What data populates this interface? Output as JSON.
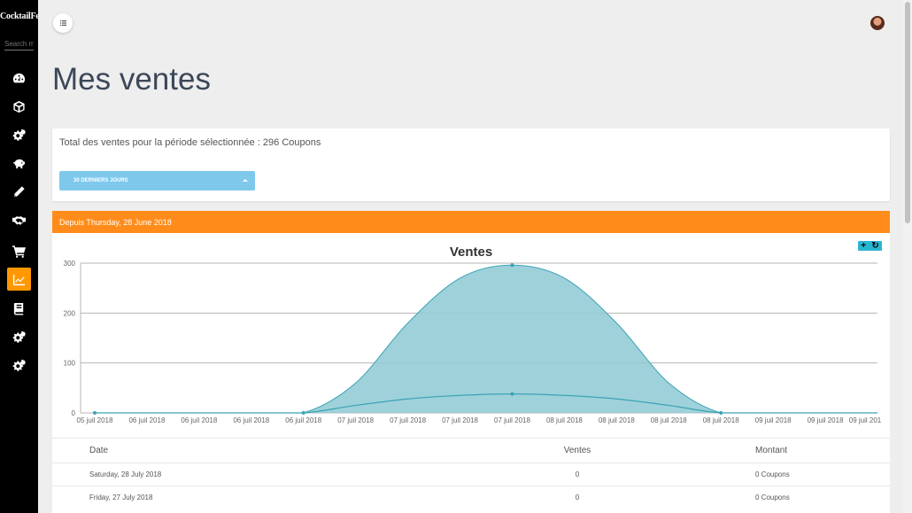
{
  "sidebar": {
    "brand": "CocktailFest",
    "search_placeholder": "Search menu",
    "items": [
      {
        "icon": "dashboard-icon"
      },
      {
        "icon": "cube-icon"
      },
      {
        "icon": "cogs-icon"
      },
      {
        "icon": "piggy-bank-icon"
      },
      {
        "icon": "pencil-icon"
      },
      {
        "icon": "handshake-icon"
      },
      {
        "icon": "cart-icon"
      },
      {
        "icon": "line-chart-icon",
        "active": true
      },
      {
        "icon": "book-icon"
      },
      {
        "icon": "cogs-icon"
      },
      {
        "icon": "cogs-icon"
      }
    ]
  },
  "page": {
    "title": "Mes ventes",
    "summary": "Total des ventes pour la période sélectionnée : 296 Coupons",
    "period_button": "30 DERNIERS JOURS",
    "range_header": "Depuis Thursday, 28 June 2018"
  },
  "colors": {
    "accent_orange": "#ff8c1a",
    "button_blue": "#7ec8ec",
    "area_fill": "#8ec9d4",
    "line": "#3aa3b5"
  },
  "chart_data": {
    "type": "area",
    "title": "Ventes",
    "ylim": [
      0,
      300
    ],
    "yticks": [
      0,
      100,
      200,
      300
    ],
    "grid": true,
    "x": [
      "05 juil 2018",
      "06 juil 2018",
      "06 juil 2018",
      "06 juil 2018",
      "06 juil 2018",
      "07 juil 2018",
      "07 juil 2018",
      "07 juil 2018",
      "07 juil 2018",
      "08 juil 2018",
      "08 juil 2018",
      "08 juil 2018",
      "08 juil 2018",
      "09 juil 2018",
      "09 juil 2018",
      "09 juil 201"
    ],
    "series": [
      {
        "values": [
          0,
          0,
          0,
          0,
          0,
          60,
          180,
          270,
          296,
          270,
          180,
          60,
          0,
          0,
          0,
          0
        ]
      },
      {
        "values": [
          0,
          0,
          0,
          0,
          0,
          15,
          28,
          35,
          38,
          35,
          28,
          15,
          0,
          0,
          0,
          0
        ]
      }
    ]
  },
  "table": {
    "headers": [
      "Date",
      "Ventes",
      "Montant"
    ],
    "rows": [
      [
        "Saturday, 28 July 2018",
        "0",
        "0 Coupons"
      ],
      [
        "Friday, 27 July 2018",
        "0",
        "0 Coupons"
      ]
    ]
  }
}
